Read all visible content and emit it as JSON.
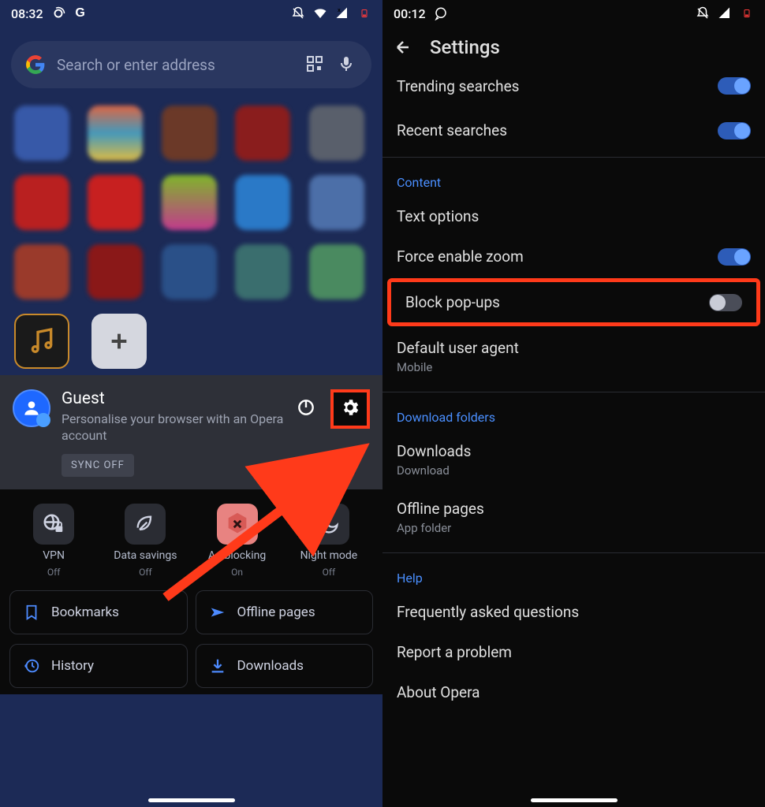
{
  "left": {
    "status": {
      "time": "08:32"
    },
    "search": {
      "placeholder": "Search or enter address"
    },
    "account": {
      "title": "Guest",
      "subtitle": "Personalise your browser with an Opera account",
      "sync_badge": "SYNC OFF"
    },
    "quick": [
      {
        "title": "VPN",
        "sub": "Off"
      },
      {
        "title": "Data savings",
        "sub": "Off"
      },
      {
        "title": "Ad blocking",
        "sub": "On"
      },
      {
        "title": "Night mode",
        "sub": "Off"
      }
    ],
    "cards": [
      {
        "label": "Bookmarks"
      },
      {
        "label": "Offline pages"
      },
      {
        "label": "History"
      },
      {
        "label": "Downloads"
      }
    ]
  },
  "right": {
    "status": {
      "time": "00:12"
    },
    "header": "Settings",
    "items": {
      "trending": "Trending searches",
      "recent": "Recent searches",
      "section_content": "Content",
      "text_options": "Text options",
      "force_zoom": "Force enable zoom",
      "block_popups": "Block pop-ups",
      "default_ua": "Default user agent",
      "default_ua_sub": "Mobile",
      "section_download": "Download folders",
      "downloads": "Downloads",
      "downloads_sub": "Download",
      "offline_pages": "Offline pages",
      "offline_pages_sub": "App folder",
      "section_help": "Help",
      "faq": "Frequently asked questions",
      "report": "Report a problem",
      "about": "About Opera"
    }
  }
}
